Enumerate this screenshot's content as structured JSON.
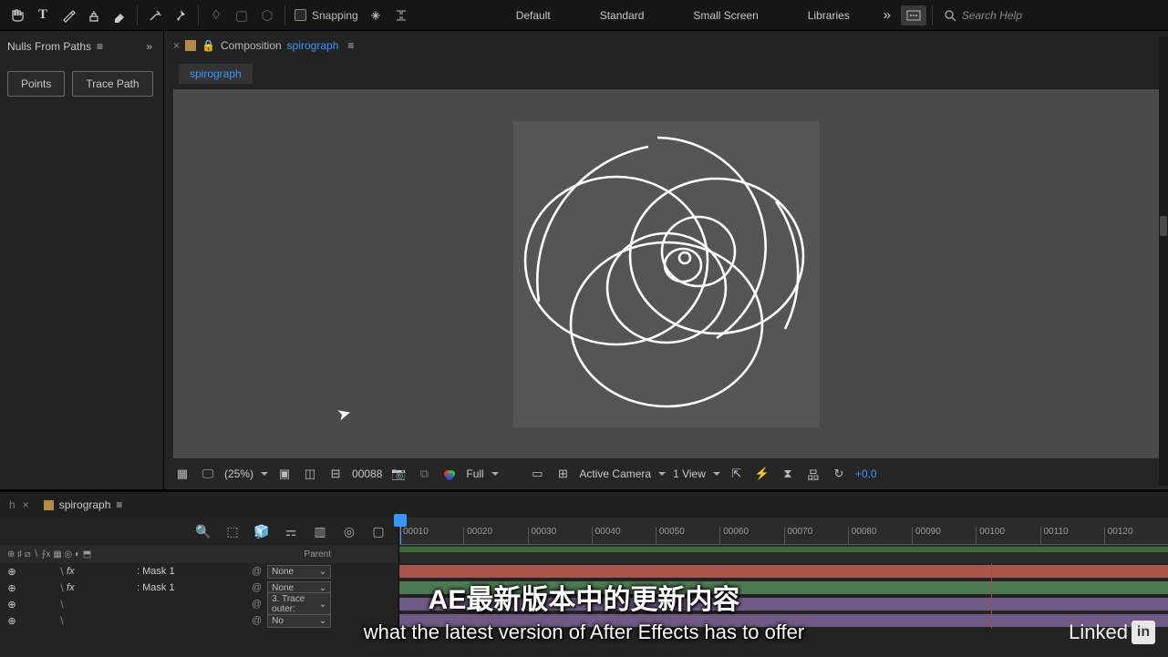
{
  "toolbar": {
    "snapping_label": "Snapping",
    "workspaces": [
      "Default",
      "Standard",
      "Small Screen",
      "Libraries"
    ],
    "search_placeholder": "Search Help"
  },
  "left_panel": {
    "title": "Nulls From Paths",
    "buttons": {
      "points": "Points",
      "trace": "Trace Path"
    }
  },
  "comp_bar": {
    "label": "Composition",
    "name": "spirograph",
    "layer_tab": "spirograph"
  },
  "viewer_footer": {
    "zoom": "(25%)",
    "frame": "00088",
    "resolution": "Full",
    "camera": "Active Camera",
    "views": "1 View",
    "exposure": "+0.0"
  },
  "timeline": {
    "tab_name": "spirograph",
    "ruler": [
      "00010",
      "00020",
      "00030",
      "00040",
      "00050",
      "00060",
      "00070",
      "00080",
      "00090",
      "00100",
      "00110",
      "00120"
    ],
    "parent_header": "Parent",
    "rows": [
      {
        "name": ": Mask 1",
        "fx": true,
        "parent": "None",
        "color": "bar-red"
      },
      {
        "name": ": Mask 1",
        "fx": true,
        "parent": "None",
        "color": "bar-green"
      },
      {
        "name": "",
        "fx": false,
        "parent": "3. Trace outer:",
        "color": "bar-purple"
      },
      {
        "name": "",
        "fx": false,
        "parent": "No",
        "color": "bar-purple"
      }
    ]
  },
  "subtitles": {
    "cn": "AE最新版本中的更新内容",
    "en": "what the latest version of After Effects has to offer"
  },
  "branding": {
    "linkedin": "Linked"
  }
}
